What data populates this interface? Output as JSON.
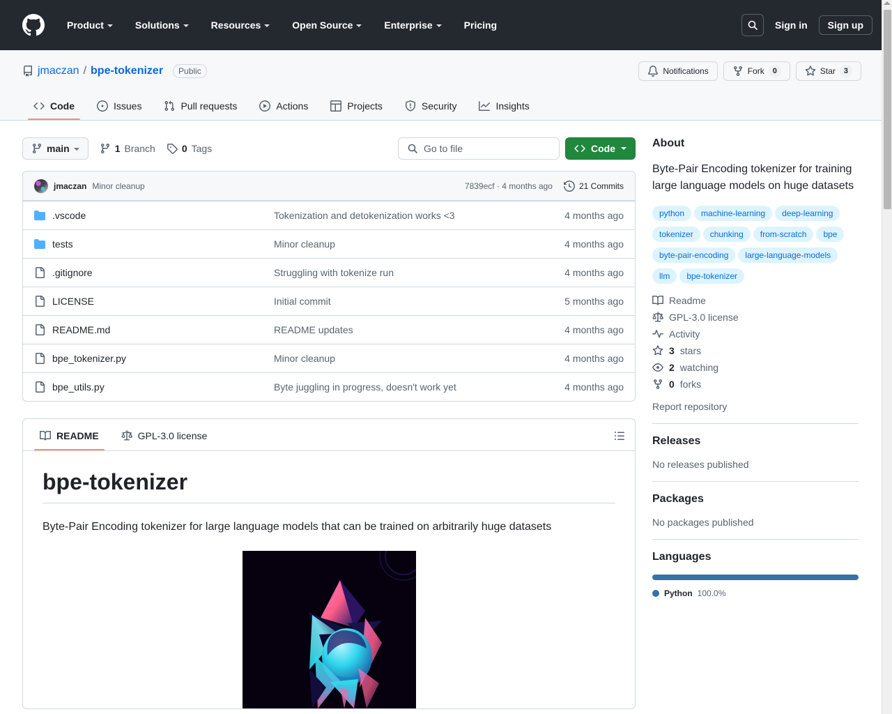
{
  "global_nav": {
    "logo_icon": "github-mark-icon",
    "items": [
      {
        "label": "Product",
        "has_caret": true
      },
      {
        "label": "Solutions",
        "has_caret": true
      },
      {
        "label": "Resources",
        "has_caret": true
      },
      {
        "label": "Open Source",
        "has_caret": true
      },
      {
        "label": "Enterprise",
        "has_caret": true
      },
      {
        "label": "Pricing",
        "has_caret": false
      }
    ],
    "search_icon": "search-icon",
    "sign_in": "Sign in",
    "sign_up": "Sign up"
  },
  "repo": {
    "repo_icon": "repo-icon",
    "owner": "jmaczan",
    "separator": "/",
    "name": "bpe-tokenizer",
    "visibility": "Public",
    "actions": [
      {
        "label": "Notifications",
        "icon": "bell-icon",
        "count": null
      },
      {
        "label": "Fork",
        "icon": "fork-icon",
        "count": "0"
      },
      {
        "label": "Star",
        "icon": "star-icon",
        "count": "3"
      }
    ],
    "tabs": [
      {
        "label": "Code",
        "icon": "code-icon",
        "active": true
      },
      {
        "label": "Issues",
        "icon": "issue-opened-icon",
        "active": false
      },
      {
        "label": "Pull requests",
        "icon": "git-pull-request-icon",
        "active": false
      },
      {
        "label": "Actions",
        "icon": "play-icon",
        "active": false
      },
      {
        "label": "Projects",
        "icon": "table-icon",
        "active": false
      },
      {
        "label": "Security",
        "icon": "shield-icon",
        "active": false
      },
      {
        "label": "Insights",
        "icon": "graph-icon",
        "active": false
      }
    ]
  },
  "file_bar": {
    "branch": "main",
    "branch_icon": "git-branch-icon",
    "branches_count": "1",
    "branches_label": "Branch",
    "tags_count": "0",
    "tags_label": "Tags",
    "tag_icon": "tag-icon",
    "search_placeholder": "Go to file",
    "search_icon": "search-icon",
    "code_button": "Code",
    "code_button_icon": "code-icon",
    "code_button_color": "#1f883d"
  },
  "commit_bar": {
    "avatar": "user-avatar",
    "author": "jmaczan",
    "message": "Minor cleanup",
    "sha": "7839ecf",
    "sha_separator": " · ",
    "relative_time": "4 months ago",
    "history_icon": "history-icon",
    "commits_count": "21 Commits"
  },
  "files": [
    {
      "type": "folder",
      "icon": "folder-icon",
      "name": ".vscode",
      "message": "Tokenization and detokenization works <3",
      "age": "4 months ago"
    },
    {
      "type": "folder",
      "icon": "folder-icon",
      "name": "tests",
      "message": "Minor cleanup",
      "age": "4 months ago"
    },
    {
      "type": "file",
      "icon": "file-icon",
      "name": ".gitignore",
      "message": "Struggling with tokenize run",
      "age": "4 months ago"
    },
    {
      "type": "file",
      "icon": "file-icon",
      "name": "LICENSE",
      "message": "Initial commit",
      "age": "5 months ago"
    },
    {
      "type": "file",
      "icon": "file-icon",
      "name": "README.md",
      "message": "README updates",
      "age": "4 months ago"
    },
    {
      "type": "file",
      "icon": "file-icon",
      "name": "bpe_tokenizer.py",
      "message": "Minor cleanup",
      "age": "4 months ago"
    },
    {
      "type": "file",
      "icon": "file-icon",
      "name": "bpe_utils.py",
      "message": "Byte juggling in progress, doesn't work yet",
      "age": "4 months ago"
    }
  ],
  "readme": {
    "tabs": [
      {
        "label": "README",
        "icon": "book-icon",
        "active": true
      },
      {
        "label": "GPL-3.0 license",
        "icon": "law-icon",
        "active": false
      }
    ],
    "outline_icon": "list-unordered-icon",
    "heading": "bpe-tokenizer",
    "paragraph": "Byte-Pair Encoding tokenizer for large language models that can be trained on arbitrarily huge datasets",
    "image_alt": "abstract-artwork-image"
  },
  "sidebar": {
    "about": {
      "heading": "About",
      "description": "Byte-Pair Encoding tokenizer for training large language models on huge datasets",
      "topics": [
        "python",
        "machine-learning",
        "deep-learning",
        "tokenizer",
        "chunking",
        "from-scratch",
        "bpe",
        "byte-pair-encoding",
        "large-language-models",
        "llm",
        "bpe-tokenizer"
      ],
      "links": [
        {
          "icon": "book-icon",
          "label": "Readme",
          "value": null
        },
        {
          "icon": "law-icon",
          "label": "GPL-3.0 license",
          "value": null
        },
        {
          "icon": "pulse-icon",
          "label": "Activity",
          "value": null
        },
        {
          "icon": "star-icon",
          "label": "stars",
          "value": "3"
        },
        {
          "icon": "eye-icon",
          "label": "watching",
          "value": "2"
        },
        {
          "icon": "fork-icon",
          "label": "forks",
          "value": "0"
        }
      ],
      "report": "Report repository"
    },
    "releases": {
      "heading": "Releases",
      "empty": "No releases published"
    },
    "packages": {
      "heading": "Packages",
      "empty": "No packages published"
    },
    "languages": {
      "heading": "Languages",
      "items": [
        {
          "name": "Python",
          "percent": "100.0%",
          "color": "#3572A5",
          "width": "100%"
        }
      ]
    }
  },
  "scrollbar": {
    "up_arrow_icon": "scroll-up-arrow-icon",
    "thumb": "scroll-thumb"
  }
}
